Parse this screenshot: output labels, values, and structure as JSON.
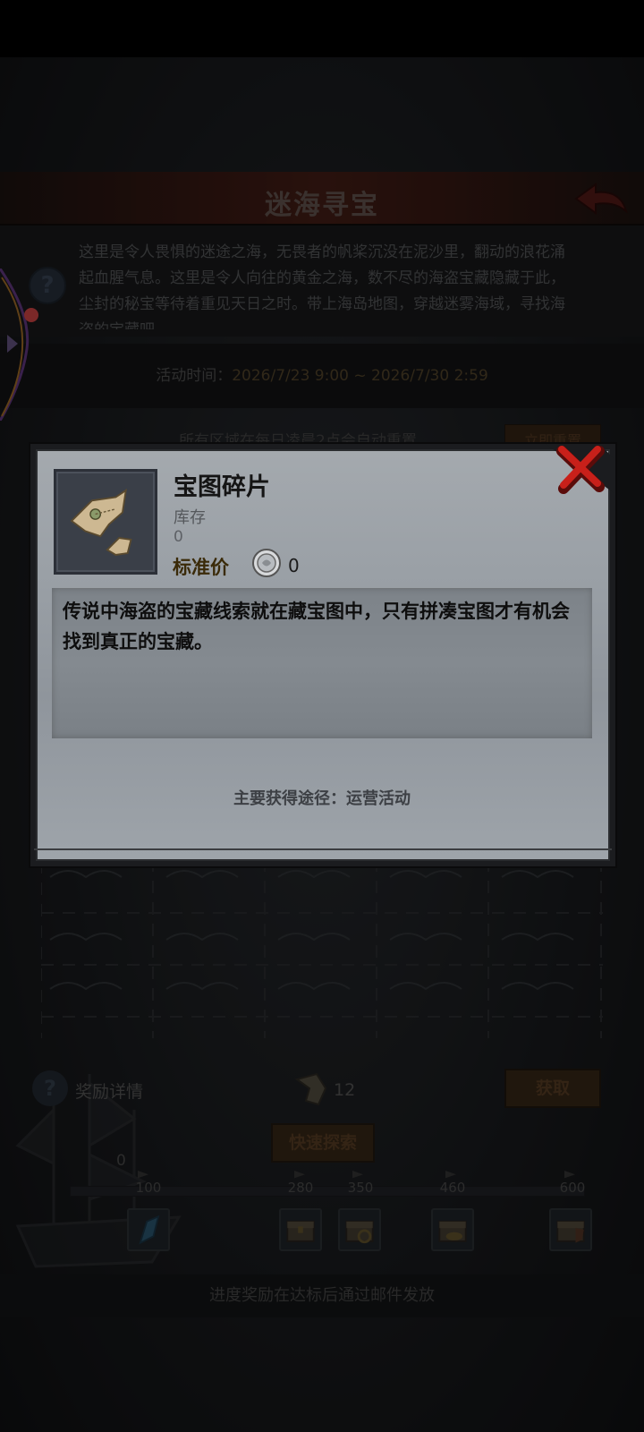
{
  "page": {
    "title": "迷海寻宝",
    "intro": "这里是令人畏惧的迷途之海，无畏者的帆桨沉没在泥沙里，翻动的浪花涌起血腥气息。这里是令人向往的黄金之海，数不尽的海盗宝藏隐藏于此，尘封的秘宝等待着重见天日之时。带上海岛地图，穿越迷雾海域，寻找海盗的宝藏吧",
    "activity_time_label": "活动时间：",
    "activity_time_value": "2026/7/23 9:00 ~ 2026/7/30 2:59",
    "bg_row_text": "所有区域在每日凌晨2点会自动重置",
    "bg_button": "立即重置",
    "reward_details": "奖励详情",
    "map_count": "12",
    "obtain_button": "获取",
    "quick_explore_button": "快速探索",
    "progress_current": "0",
    "progress_fraction": 0.0,
    "milestones": [
      "100",
      "280",
      "350",
      "460",
      "600"
    ],
    "reward_icons": [
      "crystal-icon",
      "chest-icon",
      "chest-icon",
      "chest-icon",
      "chest-icon"
    ],
    "footer_note": "进度奖励在达标后通过邮件发放"
  },
  "modal": {
    "item_name": "宝图碎片",
    "stock_label": "库存",
    "stock_value": "0",
    "price_label": "标准价",
    "price_value": "0",
    "description": "传说中海盗的宝藏线索就在藏宝图中，只有拼凑宝图才有机会找到真正的宝藏。",
    "source": "主要获得途径：运营活动",
    "item_icon": "treasure-map-fragment-icon",
    "coin_icon": "silver-coin-icon"
  },
  "colors": {
    "accent_red": "#c8201a",
    "price_gold": "#3a2a08",
    "modal_bg": "#9aa0a6"
  }
}
